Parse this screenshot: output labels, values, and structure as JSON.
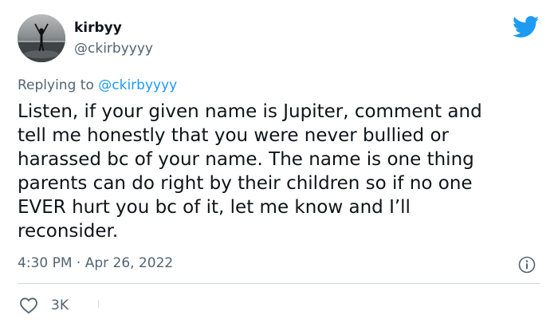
{
  "author": {
    "display_name": "kirbyy",
    "handle": "@ckirbyyyy",
    "avatar_icon": "avatar-silhouette-beach"
  },
  "reply_context": {
    "prefix": "Replying to ",
    "mention": "@ckirbyyyy"
  },
  "tweet": {
    "text": "Listen, if your given name is Jupiter, comment and\ntell me honestly that you were never bullied or\nharassed bc of your name. The name is one thing\nparents can do right by their children so if no one\nEVER hurt you bc of it, let me know and I’ll\nreconsider."
  },
  "meta": {
    "timestamp": "4:30 PM · Apr 26, 2022"
  },
  "actions": {
    "like_count": "3K"
  },
  "icons": {
    "brand": "twitter-bird-icon",
    "info": "info-icon",
    "like": "heart-icon"
  },
  "colors": {
    "brand_blue": "#1d9bf0",
    "text_primary": "#0f1419",
    "text_secondary": "#536471",
    "divider": "#cfd9de"
  }
}
